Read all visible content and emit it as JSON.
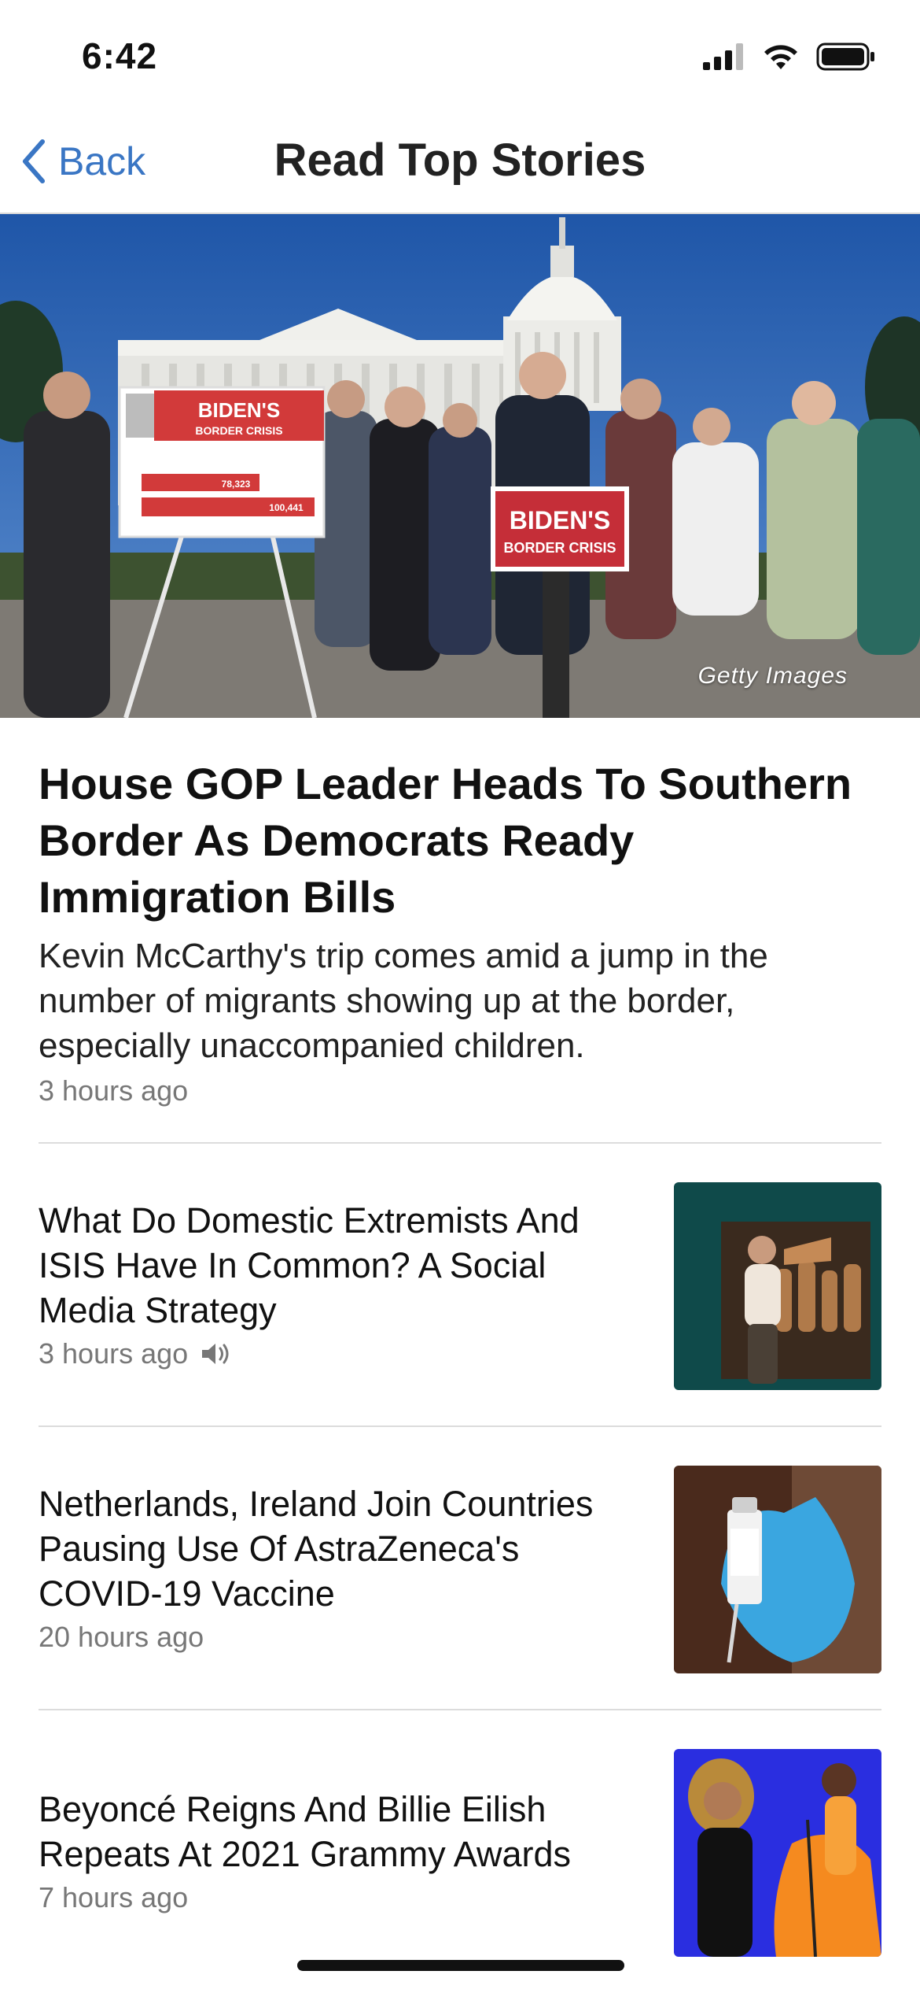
{
  "status_bar": {
    "time": "6:42"
  },
  "nav": {
    "back_label": "Back",
    "title": "Read Top Stories"
  },
  "hero": {
    "credit": "Getty Images",
    "sign_large": {
      "line1": "BIDEN'S",
      "line2": "BORDER CRISIS",
      "stat1": "78,323",
      "stat2": "100,441"
    },
    "sign_podium": {
      "line1": "BIDEN'S",
      "line2": "BORDER CRISIS"
    }
  },
  "lead_story": {
    "headline": "House GOP Leader Heads To Southern Border As Democrats Ready Immigration Bills",
    "summary": "Kevin McCarthy's trip comes amid a jump in the number of migrants showing up at the border, especially unaccompanied children.",
    "time": "3 hours ago"
  },
  "stories": [
    {
      "headline": "What Do Domestic Extremists And ISIS Have In Common? A Social Media Strategy",
      "time": "3 hours ago",
      "has_audio": true
    },
    {
      "headline": "Netherlands, Ireland Join Countries Pausing Use Of AstraZeneca's COVID-19 Vaccine",
      "time": "20 hours ago"
    },
    {
      "headline": "Beyoncé Reigns And Billie Eilish Repeats At 2021 Grammy Awards",
      "time": "7 hours ago"
    }
  ],
  "colors": {
    "accent": "#3a76c4",
    "sign_red": "#d23a3a",
    "sky": "#2f68b8"
  }
}
